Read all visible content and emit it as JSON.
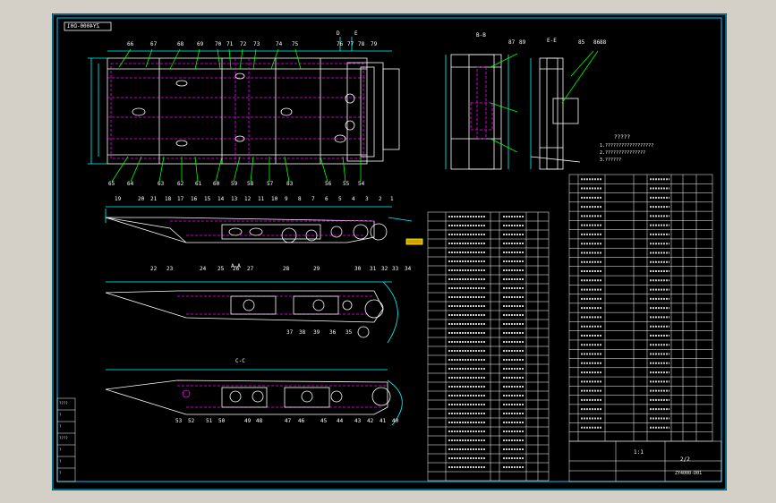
{
  "drawing": {
    "number_box": "ZY4000-D01",
    "scale_mark": "1:1",
    "title_scale": "2/2",
    "title_code": "ZY4000-D01",
    "tech_note": "?????",
    "note_lines": [
      "1.??????????????????",
      "2.???????????????",
      "3.??????"
    ],
    "colors": {
      "background": "#000000",
      "frame": "#00c8ff",
      "part": "#ffffff",
      "hidden": "#ff00ff",
      "dim": "#00ffff",
      "text": "#ffffff",
      "leader": "#00ff00",
      "accent": "#ffff00"
    }
  },
  "sections": {
    "aa": "A-A",
    "bb": "B-B",
    "cc": "C-C",
    "ee": "E-E",
    "section_d": "D",
    "section_e_top": "E"
  },
  "balloons_top": [
    "66",
    "67",
    "68",
    "69",
    "70",
    "71",
    "72",
    "73",
    "74",
    "75",
    "76",
    "77",
    "78",
    "79"
  ],
  "balloons_top_bottom": [
    "65",
    "64",
    "63",
    "62",
    "61",
    "60",
    "59",
    "58",
    "57",
    "83",
    "56",
    "55",
    "54"
  ],
  "balloons_view1": [
    "19",
    "20",
    "21",
    "18",
    "17",
    "16",
    "15",
    "14",
    "13",
    "12",
    "11",
    "10",
    "9",
    "8",
    "7",
    "6",
    "5",
    "4",
    "3",
    "2",
    "1"
  ],
  "balloons_view2": [
    "22",
    "23",
    "24",
    "25",
    "26",
    "27",
    "28",
    "29",
    "30",
    "31",
    "32",
    "33",
    "34"
  ],
  "balloons_view2_bottom": [
    "37",
    "38",
    "39",
    "36",
    "35"
  ],
  "balloons_view3_bottom": [
    "53",
    "52",
    "51",
    "50",
    "49",
    "48",
    "47",
    "46",
    "45",
    "44",
    "43",
    "42",
    "41",
    "40"
  ],
  "balloons_section": [
    "85",
    "86",
    "88",
    "87",
    "89"
  ],
  "left_table": [
    "????",
    "?",
    "?",
    "????",
    "?",
    "?",
    "?"
  ],
  "bom_left_rows": 30,
  "bom_right_rows": 29
}
